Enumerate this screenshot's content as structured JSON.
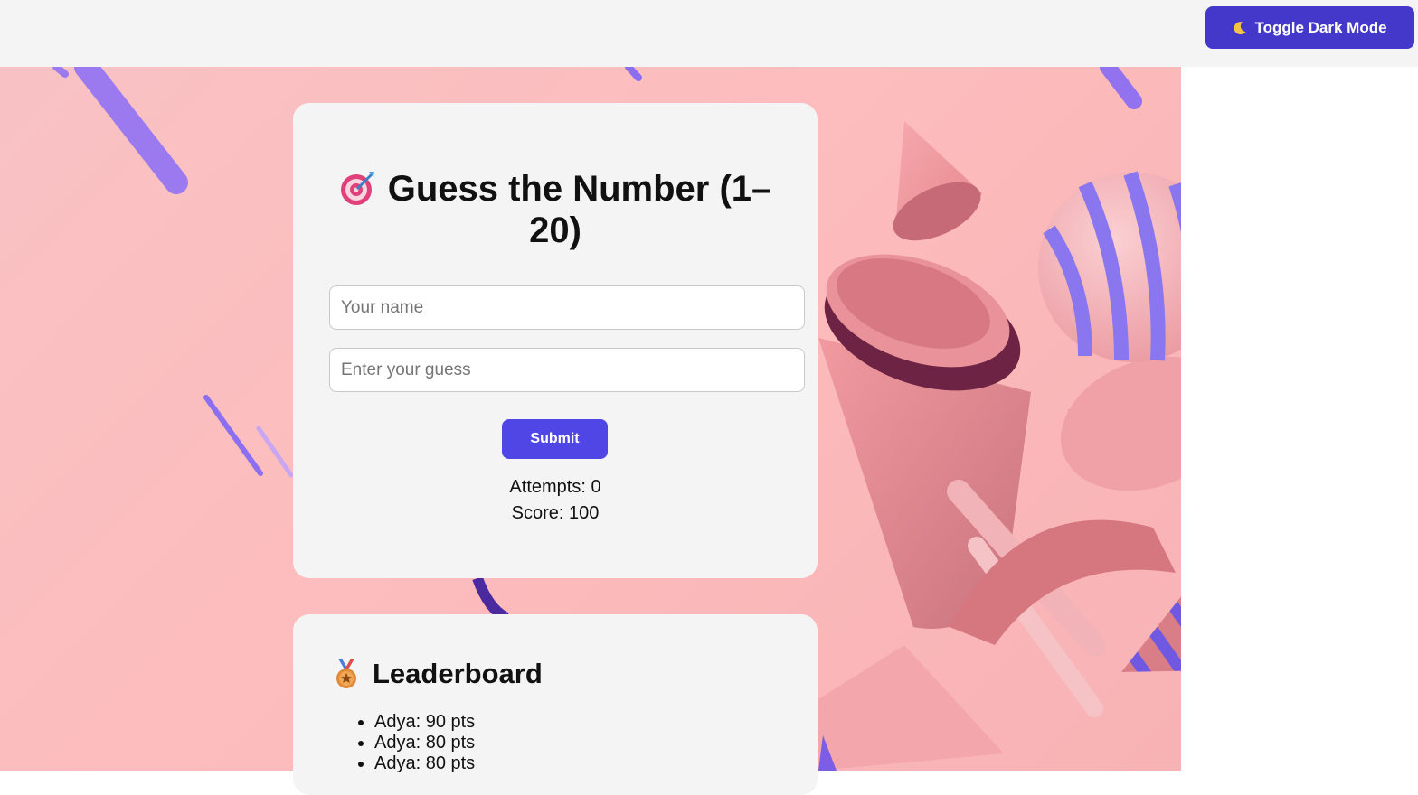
{
  "toolbar": {
    "toggle_label": "Toggle Dark Mode",
    "toggle_icon": "moon-icon"
  },
  "game": {
    "title": "Guess the Number (1–20)",
    "title_icon": "target-icon",
    "name_placeholder": "Your name",
    "name_value": "",
    "guess_placeholder": "Enter your guess",
    "guess_value": "",
    "submit_label": "Submit",
    "attempts_text": "Attempts: 0",
    "score_text": "Score: 100"
  },
  "leaderboard": {
    "title": "Leaderboard",
    "title_icon": "medal-icon",
    "entries": [
      "Adya: 90 pts",
      "Adya: 80 pts",
      "Adya: 80 pts"
    ]
  },
  "colors": {
    "accent": "#4f46e5",
    "toggle_bg": "#4338ca",
    "card_bg": "#f4f4f4",
    "hero_pink": "#fdbcbd",
    "stripe_purple": "#8b7bf0"
  }
}
